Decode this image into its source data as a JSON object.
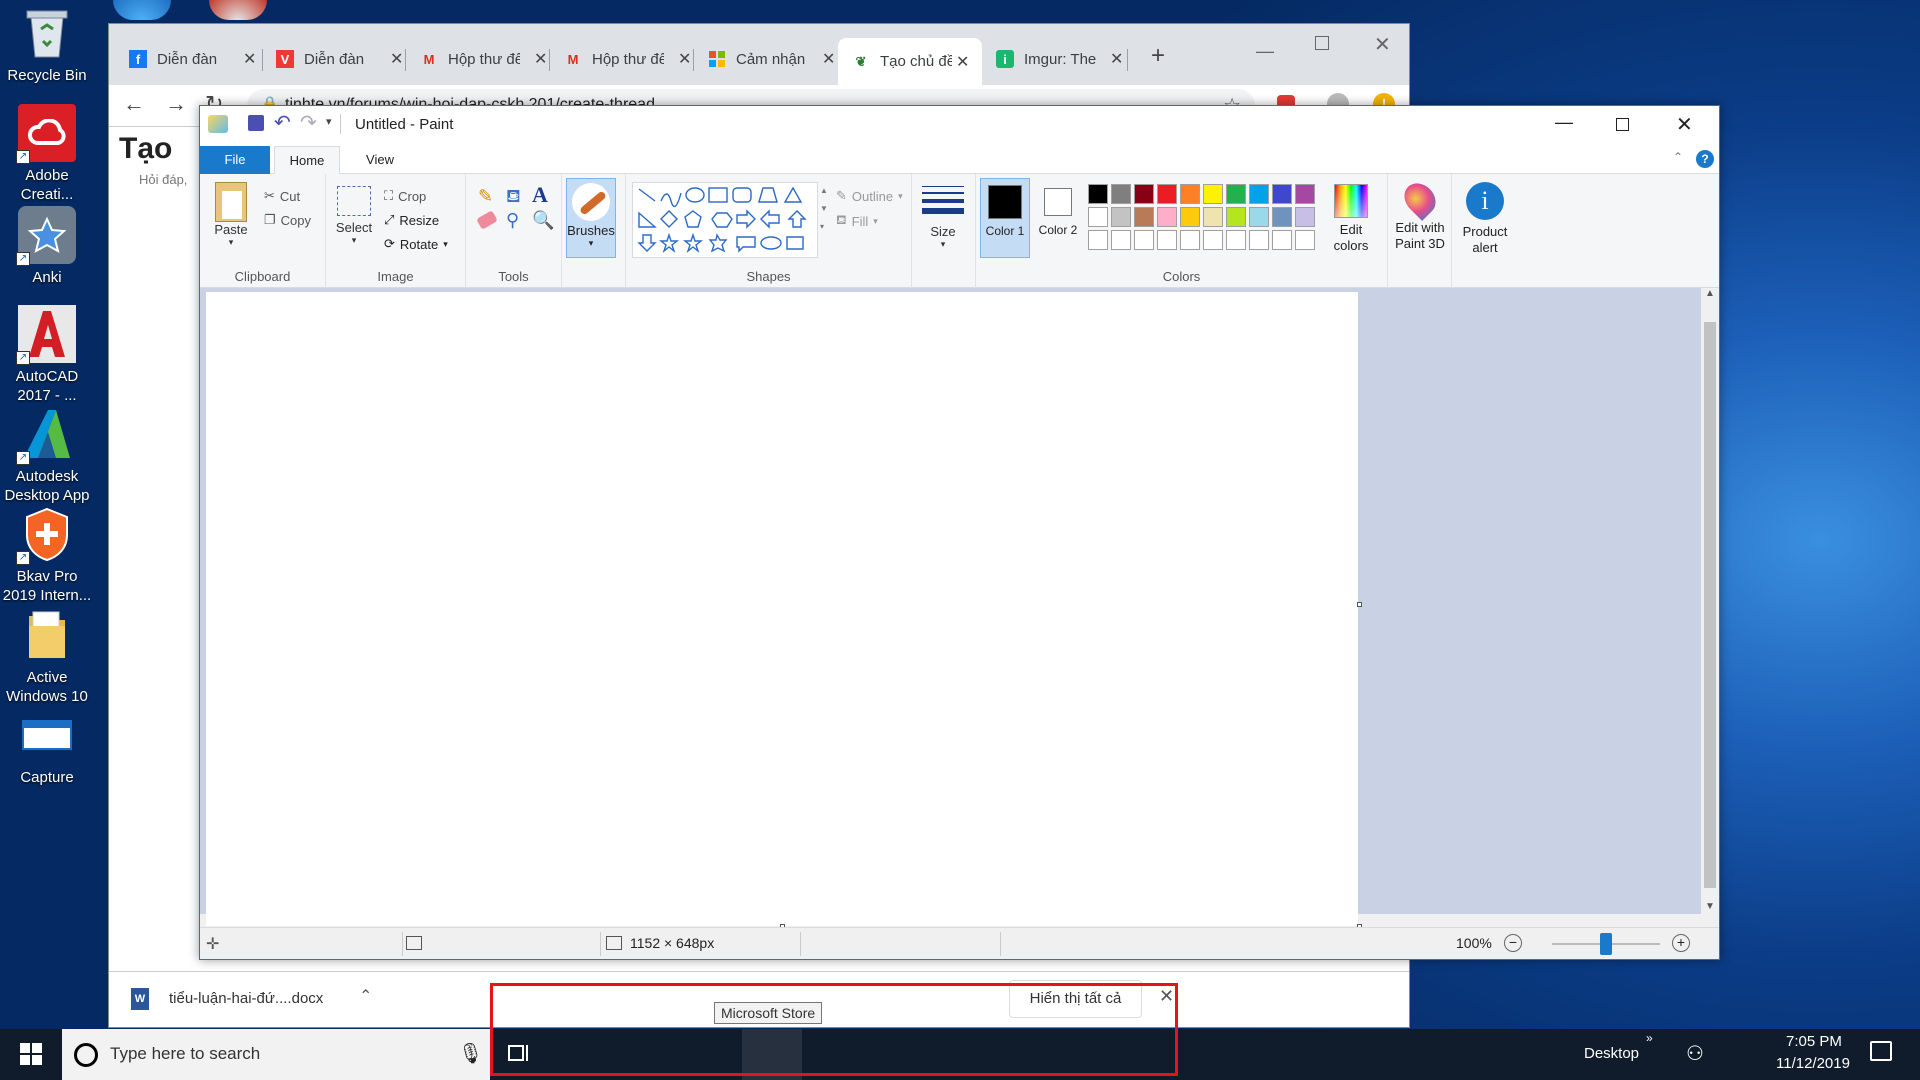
{
  "desktop": {
    "icons": [
      {
        "label": "Recycle Bin",
        "name": "recycle-bin-icon"
      },
      {
        "label": "Adobe Creati...",
        "name": "adobe-creative-cloud-icon"
      },
      {
        "label": "Anki",
        "name": "anki-icon"
      },
      {
        "label": "AutoCAD 2017 - ...",
        "name": "autocad-icon"
      },
      {
        "label": "Autodesk Desktop App",
        "name": "autodesk-icon"
      },
      {
        "label": "Bkav Pro 2019 Intern...",
        "name": "bkav-icon"
      },
      {
        "label": "Active Windows 10",
        "name": "folder-icon"
      },
      {
        "label": "Capture",
        "name": "capture-icon"
      }
    ]
  },
  "browser": {
    "tabs": [
      {
        "label": "Diễn đàn",
        "icon": "facebook-icon"
      },
      {
        "label": "Diễn đàn",
        "icon": "vivaldi-icon"
      },
      {
        "label": "Hộp thư đến",
        "icon": "gmail-icon"
      },
      {
        "label": "Hộp thư đến",
        "icon": "gmail-icon"
      },
      {
        "label": "Cảm nhận",
        "icon": "microsoft-icon"
      },
      {
        "label": "Tạo chủ đề",
        "icon": "tinhte-icon"
      },
      {
        "label": "Imgur: The",
        "icon": "imgur-icon"
      }
    ],
    "url": "tinhte.vn/forums/win-hoi-dap-cskh.201/create-thread",
    "page_title": "Tạo",
    "page_sub": "Hỏi đáp,",
    "download_file": "tiểu-luận-hai-đứ....docx",
    "show_all": "Hiển thị tất cả"
  },
  "paint": {
    "title": "Untitled - Paint",
    "tabs": {
      "file": "File",
      "home": "Home",
      "view": "View"
    },
    "clipboard": {
      "paste": "Paste",
      "cut": "Cut",
      "copy": "Copy",
      "label": "Clipboard"
    },
    "image": {
      "select": "Select",
      "crop": "Crop",
      "resize": "Resize",
      "rotate": "Rotate",
      "label": "Image"
    },
    "tools": {
      "label": "Tools"
    },
    "brushes": "Brushes",
    "shapes": {
      "outline": "Outline",
      "fill": "Fill",
      "label": "Shapes"
    },
    "size": "Size",
    "color1": "Color 1",
    "color2": "Color 2",
    "colors_label": "Colors",
    "edit_colors": "Edit colors",
    "paint3d": "Edit with Paint 3D",
    "product_alert": "Product alert",
    "palette_row1": [
      "#000000",
      "#7f7f7f",
      "#880015",
      "#ed1c24",
      "#ff7f27",
      "#fff200",
      "#22b14c",
      "#00a2e8",
      "#3f48cc",
      "#a349a4"
    ],
    "palette_row2": [
      "#ffffff",
      "#c3c3c3",
      "#b97a57",
      "#ffaec9",
      "#ffc90e",
      "#efe4b0",
      "#b5e61d",
      "#99d9ea",
      "#7092be",
      "#c8bfe7"
    ],
    "status": {
      "dimensions": "1152 × 648px",
      "zoom": "100%"
    }
  },
  "tooltip": "Microsoft Store",
  "taskbar": {
    "search_placeholder": "Type here to search",
    "desktop_label": "Desktop",
    "time": "7:05 PM",
    "date": "11/12/2019"
  }
}
